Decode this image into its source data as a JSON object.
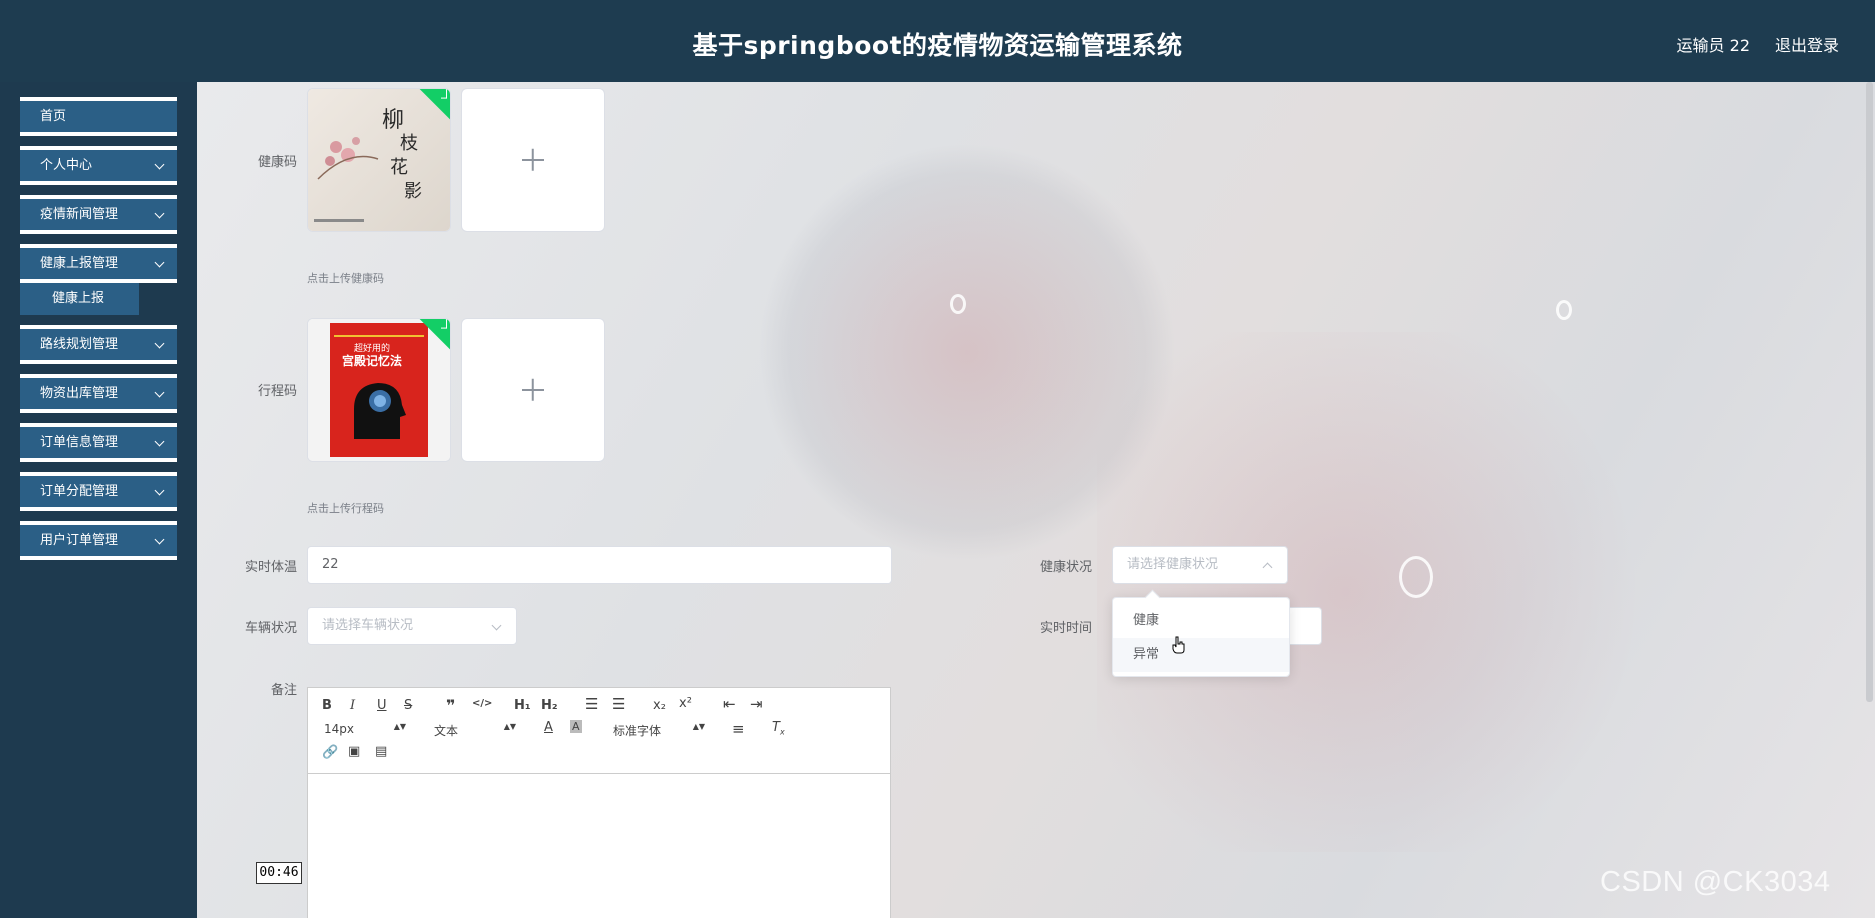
{
  "header": {
    "title": "基于springboot的疫情物资运输管理系统",
    "user": "运输员 22",
    "logout": "退出登录"
  },
  "sidebar": {
    "items": [
      {
        "label": "首页",
        "has_children": false
      },
      {
        "label": "个人中心",
        "has_children": true
      },
      {
        "label": "疫情新闻管理",
        "has_children": true
      },
      {
        "label": "健康上报管理",
        "has_children": true
      },
      {
        "label": "路线规划管理",
        "has_children": true
      },
      {
        "label": "物资出库管理",
        "has_children": true
      },
      {
        "label": "订单信息管理",
        "has_children": true
      },
      {
        "label": "订单分配管理",
        "has_children": true
      },
      {
        "label": "用户订单管理",
        "has_children": true
      }
    ],
    "active_sub": "健康上报"
  },
  "form": {
    "health_code": {
      "label": "健康码",
      "tip": "点击上传健康码"
    },
    "trip_code": {
      "label": "行程码",
      "tip": "点击上传行程码"
    },
    "temperature": {
      "label": "实时体温",
      "value": "22"
    },
    "health_status": {
      "label": "健康状况",
      "placeholder": "请选择健康状况"
    },
    "vehicle_status": {
      "label": "车辆状况",
      "placeholder": "请选择车辆状况"
    },
    "realtime": {
      "label": "实时时间"
    },
    "remark": {
      "label": "备注"
    }
  },
  "dropdown": {
    "options": [
      "健康",
      "异常"
    ],
    "hovered": "异常"
  },
  "editor": {
    "font_size": "14px",
    "header_picker": "文本",
    "font_family": "标准字体"
  },
  "images": {
    "book1_title": "柳枝花影",
    "book2_title": "超好用的宫殿记忆法"
  },
  "overlay": {
    "timestamp": "00:46",
    "watermark": "CSDN @CK3034"
  },
  "colors": {
    "header_bg": "#1e3c50",
    "sidebar_bg": "#1e3a4f",
    "menu_bg": "#2b5f86",
    "success": "#13ce66"
  }
}
